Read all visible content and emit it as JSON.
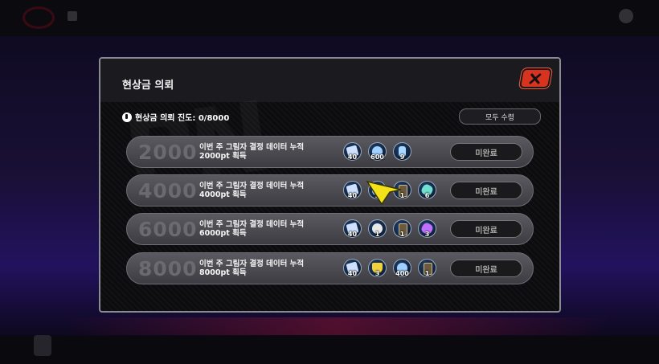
{
  "dialog": {
    "title": "현상금 의뢰",
    "progress_label": "현상금 의뢰 진도: 0/8000",
    "claim_all_label": "모두 수령"
  },
  "rows": [
    {
      "threshold": "2000",
      "desc_line1": "이번 주 그림자 결정 데이터 누적",
      "desc_line2": "2000pt 획득",
      "status": "미완료",
      "rewards": [
        {
          "icon": "ticket-icon",
          "count": "40"
        },
        {
          "icon": "cloud-icon",
          "count": "600"
        },
        {
          "icon": "drink-icon",
          "count": "9"
        }
      ]
    },
    {
      "threshold": "4000",
      "desc_line1": "이번 주 그림자 결정 데이터 누적",
      "desc_line2": "4000pt 획득",
      "status": "미완료",
      "rewards": [
        {
          "icon": "ticket-icon",
          "count": "40"
        },
        {
          "icon": "cloud-icon",
          "count": "2"
        },
        {
          "icon": "card-icon",
          "count": "1"
        },
        {
          "icon": "gem-icon",
          "count": "6"
        }
      ]
    },
    {
      "threshold": "6000",
      "desc_line1": "이번 주 그림자 결정 데이터 누적",
      "desc_line2": "6000pt 획득",
      "status": "미완료",
      "rewards": [
        {
          "icon": "ticket-icon",
          "count": "40"
        },
        {
          "icon": "disc-icon",
          "count": "1"
        },
        {
          "icon": "card-icon",
          "count": "1"
        },
        {
          "icon": "gem-icon",
          "count": "3"
        }
      ]
    },
    {
      "threshold": "8000",
      "desc_line1": "이번 주 그림자 결정 데이터 누적",
      "desc_line2": "8000pt 획득",
      "status": "미완료",
      "rewards": [
        {
          "icon": "ticket-icon",
          "count": "40"
        },
        {
          "icon": "trophy-icon",
          "count": "3"
        },
        {
          "icon": "cloud-icon",
          "count": "400"
        },
        {
          "icon": "card-icon",
          "count": "1"
        }
      ]
    }
  ]
}
